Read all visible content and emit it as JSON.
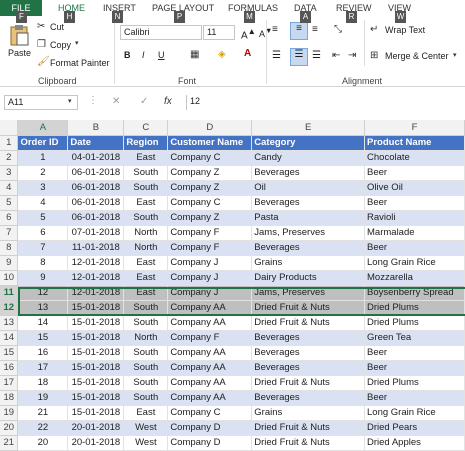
{
  "tabs": {
    "file": "FILE",
    "home": "HOME",
    "insert": "INSERT",
    "page_layout": "PAGE LAYOUT",
    "formulas": "FORMULAS",
    "data": "DATA",
    "review": "REVIEW",
    "view": "VIEW"
  },
  "keytips": {
    "file": "F",
    "home": "H",
    "insert": "N",
    "page_layout": "P",
    "formulas": "M",
    "data": "A",
    "review": "R",
    "view": "W"
  },
  "ribbon": {
    "paste": "Paste",
    "cut": "Cut",
    "copy": "Copy",
    "format_painter": "Format Painter",
    "font_name": "Calibri",
    "font_size": "11",
    "bold": "B",
    "italic": "I",
    "underline": "U",
    "wrap_text": "Wrap Text",
    "merge_center": "Merge & Center",
    "group_clipboard": "Clipboard",
    "group_font": "Font",
    "group_alignment": "Alignment"
  },
  "formula_bar": {
    "name_box": "A11",
    "fx": "fx",
    "value": "12"
  },
  "columns": [
    "A",
    "B",
    "C",
    "D",
    "E",
    "F"
  ],
  "header_row": [
    "Order ID",
    "Date",
    "Region",
    "Customer Name",
    "Category",
    "Product Name"
  ],
  "rows": [
    [
      "1",
      "04-01-2018",
      "East",
      "Company C",
      "Candy",
      "Chocolate"
    ],
    [
      "2",
      "06-01-2018",
      "South",
      "Company Z",
      "Beverages",
      "Beer"
    ],
    [
      "3",
      "06-01-2018",
      "South",
      "Company Z",
      "Oil",
      "Olive Oil"
    ],
    [
      "4",
      "06-01-2018",
      "East",
      "Company C",
      "Beverages",
      "Beer"
    ],
    [
      "5",
      "06-01-2018",
      "South",
      "Company Z",
      "Pasta",
      "Ravioli"
    ],
    [
      "6",
      "07-01-2018",
      "North",
      "Company F",
      "Jams, Preserves",
      "Marmalade"
    ],
    [
      "7",
      "11-01-2018",
      "North",
      "Company F",
      "Beverages",
      "Beer"
    ],
    [
      "8",
      "12-01-2018",
      "East",
      "Company J",
      "Grains",
      "Long Grain Rice"
    ],
    [
      "9",
      "12-01-2018",
      "East",
      "Company J",
      "Dairy Products",
      "Mozzarella"
    ],
    [
      "12",
      "12-01-2018",
      "East",
      "Company J",
      "Jams, Preserves",
      "Boysenberry Spread"
    ],
    [
      "13",
      "15-01-2018",
      "South",
      "Company AA",
      "Dried Fruit & Nuts",
      "Dried Plums"
    ],
    [
      "14",
      "15-01-2018",
      "South",
      "Company AA",
      "Dried Fruit & Nuts",
      "Dried Plums"
    ],
    [
      "15",
      "15-01-2018",
      "North",
      "Company F",
      "Beverages",
      "Green Tea"
    ],
    [
      "16",
      "15-01-2018",
      "South",
      "Company AA",
      "Beverages",
      "Beer"
    ],
    [
      "17",
      "15-01-2018",
      "South",
      "Company AA",
      "Beverages",
      "Beer"
    ],
    [
      "18",
      "15-01-2018",
      "South",
      "Company AA",
      "Dried Fruit & Nuts",
      "Dried Plums"
    ],
    [
      "19",
      "15-01-2018",
      "South",
      "Company AA",
      "Beverages",
      "Beer"
    ],
    [
      "21",
      "15-01-2018",
      "East",
      "Company C",
      "Grains",
      "Long Grain Rice"
    ],
    [
      "22",
      "20-01-2018",
      "West",
      "Company D",
      "Dried Fruit & Nuts",
      "Dried Pears"
    ],
    [
      "20",
      "20-01-2018",
      "West",
      "Company D",
      "Dried Fruit & Nuts",
      "Dried Apples"
    ]
  ]
}
